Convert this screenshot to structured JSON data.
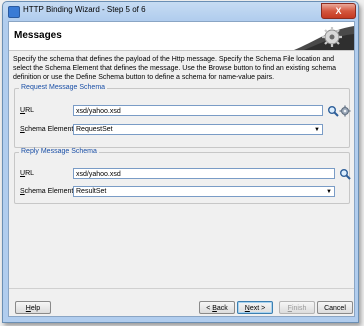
{
  "window": {
    "title": "HTTP Binding Wizard - Step 5 of 6",
    "close_glyph": "X"
  },
  "header": {
    "title": "Messages"
  },
  "description": "Specify the schema that defines the payload of the Http message.  Specify the Schema File location and select the Schema Element that defines the message. Use the Browse button to find an existing schema definition or use the Define Schema button to define a schema for name-value pairs.",
  "request": {
    "legend": "Request Message Schema",
    "url_label_u": "U",
    "url_label_rest": "RL",
    "url_value": "xsd/yahoo.xsd",
    "element_label_u": "S",
    "element_label_rest": "chema Element",
    "element_value": "RequestSet"
  },
  "reply": {
    "legend": "Reply Message Schema",
    "url_label_u": "U",
    "url_label_rest": "RL",
    "url_value": "xsd/yahoo.xsd",
    "element_label_u": "S",
    "element_label_rest": "chema Element",
    "element_value": "ResultSet"
  },
  "buttons": {
    "help_u": "H",
    "help_rest": "elp",
    "back_pre": "< ",
    "back_u": "B",
    "back_rest": "ack",
    "next_u": "N",
    "next_rest": "ext >",
    "finish_u": "F",
    "finish_rest": "inish",
    "cancel": "Cancel"
  },
  "colors": {
    "legend": "#1a4fa6",
    "field_border": "#7a9cc6"
  },
  "icons": [
    "app-icon",
    "gear-icon",
    "search-icon",
    "define-schema-icon",
    "dropdown-arrow-icon"
  ]
}
